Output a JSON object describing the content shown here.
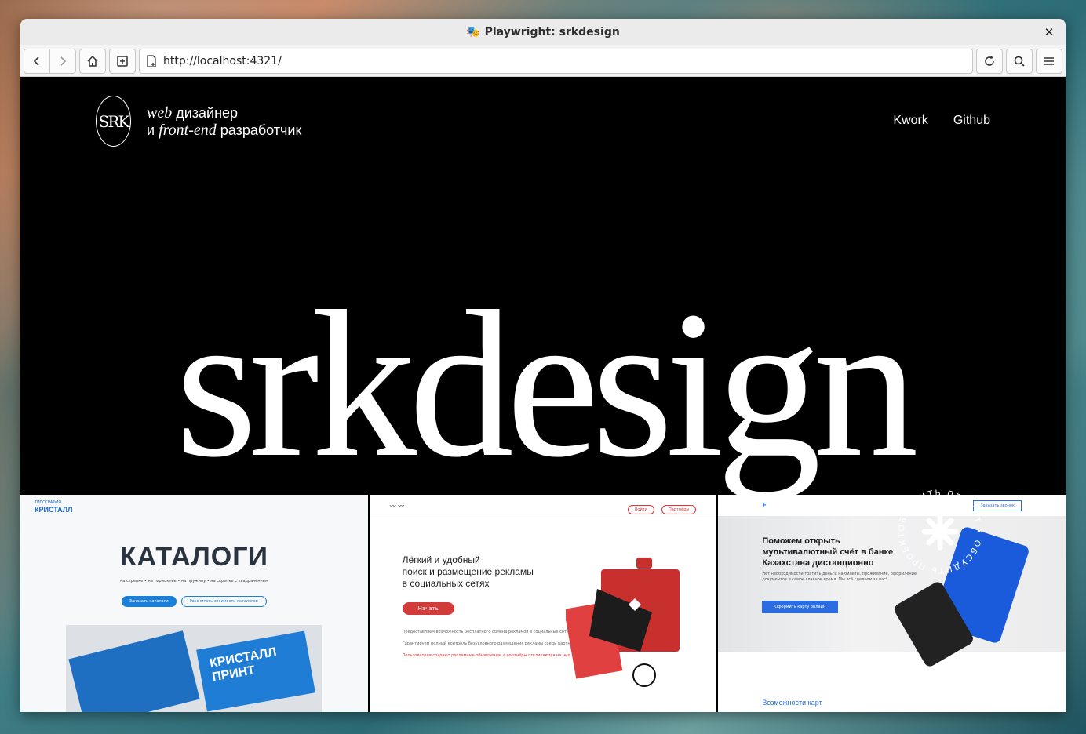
{
  "browser": {
    "window_title": "Playwright: srkdesign",
    "url": "http://localhost:4321/",
    "icons": [
      "back-icon",
      "forward-icon",
      "home-icon",
      "new-tab-icon",
      "page-icon",
      "reload-icon",
      "search-icon",
      "menu-icon",
      "close-icon"
    ]
  },
  "header": {
    "logo_text": "SRK",
    "tagline_line1_italic": "web",
    "tagline_line1_rest": " дизайнер",
    "tagline_line2_pre": "и ",
    "tagline_line2_italic": "front-end",
    "tagline_line2_rest": " разработчик",
    "nav": [
      "Kwork",
      "Github"
    ]
  },
  "hero": {
    "title": "srkdesign"
  },
  "projects": [
    {
      "brand_line1": "ТИПОГРАФИЯ",
      "brand_line2": "КРИСТАЛЛ",
      "heading": "КАТАЛОГИ",
      "subtitle": "на скрепке • на термоклее • на пружину • на скрепке с квадрачением",
      "btn_primary": "Заказать каталоги",
      "btn_secondary": "Рассчитать стоимость каталогов",
      "book_title": "КРИСТАЛЛ ПРИНТ"
    },
    {
      "heading_l1": "Лёгкий и удобный",
      "heading_l2": "поиск и размещение рекламы",
      "heading_l3": "в социальных сетях",
      "btn": "Начать",
      "nav_btns": [
        "Войти",
        "Партнёры"
      ],
      "bullets": [
        "Предоставляем возможность бесплатного обмена рекламой в социальных сетях",
        "Гарантируем полный контроль безусловного размещения рекламы среди партнёров",
        "Пользователи создают рекламные объявления, а партнёры откликаются на них"
      ]
    },
    {
      "heading_l1": "Поможем открыть",
      "heading_l2": "мультивалютный счёт в банке",
      "heading_l3": "Казахстана дистанционно",
      "desc": "Нет необходимости тратить деньги на билеты, проживание, оформление документов и самое главное время. Мы всё сделаем за вас!",
      "btn": "Оформить карту онлайн",
      "order_btn": "Заказать звонок",
      "features_title": "Возможности карт"
    }
  ],
  "badge": {
    "text": "ОБСУДИТЬ ПРОЕКТ • ОБСУДИТЬ ПРОЕКТ •"
  }
}
